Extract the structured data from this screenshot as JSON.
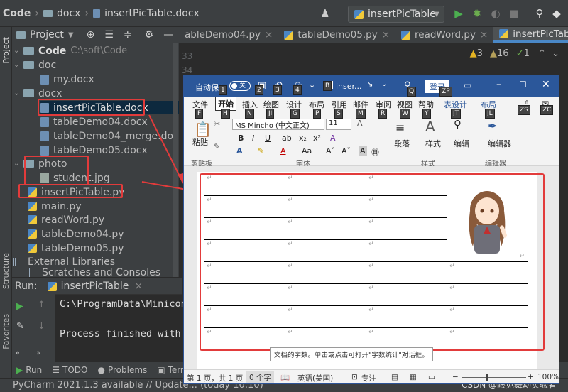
{
  "ide": {
    "breadcrumb": [
      "Code",
      "docx",
      "insertPicTable.docx"
    ],
    "run_config": "insertPicTable",
    "project_label": "Project",
    "side_tabs": {
      "project": "Project",
      "structure": "Structure",
      "favorites": "Favorites"
    },
    "tree": [
      {
        "label": "Code",
        "path": "C:\\soft\\Code",
        "kind": "folder"
      },
      {
        "label": "doc",
        "kind": "folder"
      },
      {
        "label": "my.docx",
        "kind": "docx"
      },
      {
        "label": "docx",
        "kind": "folder"
      },
      {
        "label": "insertPicTable.docx",
        "kind": "docx"
      },
      {
        "label": "tableDemo04.docx",
        "kind": "docx"
      },
      {
        "label": "tableDemo04_merge.docx",
        "kind": "docx"
      },
      {
        "label": "tableDemo05.docx",
        "kind": "docx"
      },
      {
        "label": "photo",
        "kind": "folder"
      },
      {
        "label": "student.jpg",
        "kind": "jpg"
      },
      {
        "label": "insertPicTable.py",
        "kind": "py"
      },
      {
        "label": "main.py",
        "kind": "py"
      },
      {
        "label": "readWord.py",
        "kind": "py"
      },
      {
        "label": "tableDemo04.py",
        "kind": "py"
      },
      {
        "label": "tableDemo05.py",
        "kind": "py"
      },
      {
        "label": "External Libraries",
        "kind": "lib"
      },
      {
        "label": "Scratches and Consoles",
        "kind": "lib"
      }
    ],
    "tabs": [
      "ableDemo04.py",
      "tableDemo05.py",
      "readWord.py",
      "insertPicTable.py"
    ],
    "line_numbers": [
      "33",
      "34"
    ],
    "inspections": {
      "warnings": "3",
      "weak_warnings": "16",
      "ok": "1"
    },
    "run_label": "Run:",
    "run_tab": "insertPicTable",
    "console_lines": [
      "C:\\ProgramData\\Minicon",
      "Process finished with"
    ],
    "bottom_tabs": [
      "Run",
      "TODO",
      "Problems",
      "Term"
    ],
    "status_text": "PyCharm 2021.1.3 available // Update... (today 10:10)",
    "watermark": "CSDN @眼见舞动实验者"
  },
  "word": {
    "autosave": "自动保存",
    "autosave_state": "关",
    "doc_title": "inser...",
    "login": "登录",
    "menu": [
      "文件",
      "开始",
      "插入",
      "绘图",
      "设计",
      "布局",
      "引用",
      "邮件",
      "审阅",
      "视图",
      "帮助",
      "表设计",
      "布局"
    ],
    "keytips": [
      "F",
      "H",
      "N",
      "JI",
      "G",
      "P",
      "S",
      "M",
      "R",
      "W",
      "Y",
      "JT",
      "JL",
      "ZS",
      "ZC"
    ],
    "top_keytips": [
      "1",
      "2",
      "3",
      "4",
      "B",
      "Q",
      "ZP"
    ],
    "paste_label": "粘贴",
    "clipboard_label": "剪贴板",
    "font_name": "MS Mincho (中文正文)",
    "font_size": "11",
    "font_group": "字体",
    "paragraph": "段落",
    "styles": "样式",
    "editing": "编辑",
    "editor": "编辑器",
    "editor_label2": "编\n辑器",
    "styles_group": "样式",
    "editor_group": "编辑器",
    "tooltip": "文档的字数。单击或点击可打开\"字数统计\"对话框。",
    "status_page": "第 1 页，共 1 页",
    "status_words": "0 个字",
    "status_lang": "英语(美国)",
    "status_focus": "专注",
    "zoom": "100%",
    "cell_mark": "↵"
  }
}
